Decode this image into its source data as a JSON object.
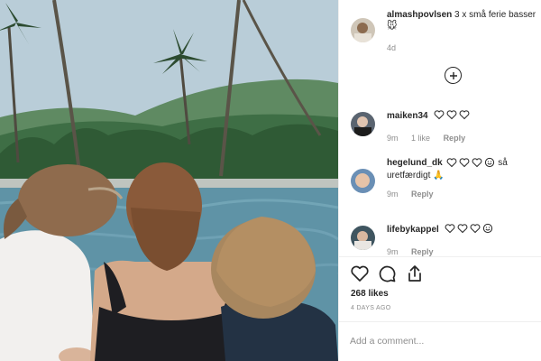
{
  "post": {
    "author": "almashpovlsen",
    "caption_text": "3 x små ferie basser",
    "caption_emoji": "🐭",
    "time": "4d",
    "likes": "268 likes",
    "posted": "4 DAYS AGO"
  },
  "comments": [
    {
      "username": "maiken34",
      "text": "",
      "hearts": 3,
      "time": "9m",
      "likes": "1 like",
      "reply": "Reply"
    },
    {
      "username": "hegelund_dk",
      "text": "uretfærdigt 🙏",
      "hearts": 3,
      "text_inline": "så",
      "time": "9m",
      "likes": "",
      "reply": "Reply"
    },
    {
      "username": "lifebykappel",
      "text": "",
      "hearts": 3,
      "time": "9m",
      "likes": "",
      "reply": "Reply"
    }
  ],
  "icons": {
    "load_more": "plus-circle-icon",
    "like": "heart-icon",
    "comment": "comment-icon",
    "share": "share-icon",
    "comment_hearts": "heart-outline-icon",
    "smile": "smile-face-icon"
  },
  "add_comment": {
    "placeholder": "Add a comment..."
  },
  "colors": {
    "text": "#262626",
    "muted": "#8e8e8e",
    "divider": "#efefef"
  }
}
